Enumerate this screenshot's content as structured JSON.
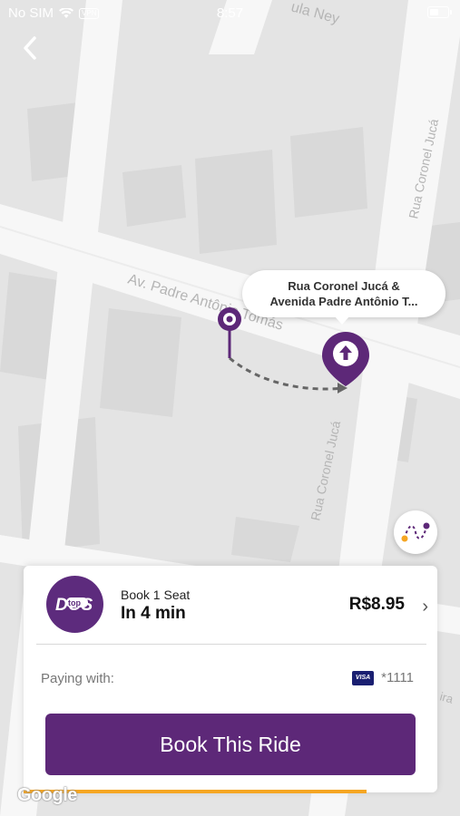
{
  "status_bar": {
    "carrier": "No SIM",
    "vpn": "VPN",
    "time": "8:57"
  },
  "map": {
    "streets": {
      "top_street": "ula Ney",
      "avenue": "Av. Padre Antônio Tomás",
      "right_street_upper": "Rua Coronel Jucá",
      "right_street_lower": "Rua Coronel Jucá",
      "bottom_right_partial": "ira"
    },
    "pickup_bubble": {
      "line1": "Rua Coronel Jucá &",
      "line2": "Avenida Padre Antônio T..."
    },
    "attribution": "Google"
  },
  "ride_card": {
    "logo_text": "top",
    "ride_type": "Book 1 Seat",
    "eta": "In 4 min",
    "price": "R$8.95",
    "paying_label": "Paying with:",
    "card_brand": "VISA",
    "card_number": "*1111",
    "book_button": "Book This Ride",
    "progress": 0.83
  },
  "colors": {
    "brand_purple": "#5d2878",
    "accent_orange": "#f5a623"
  }
}
